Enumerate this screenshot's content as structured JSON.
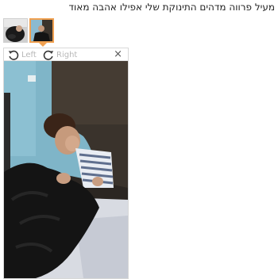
{
  "review": {
    "text": "מעיל פרווה מדהים התינוקת שלי אפילו אהבה מאוד"
  },
  "thumbnails": [
    {
      "label": "",
      "selected": false
    },
    {
      "label": "",
      "selected": true
    }
  ],
  "viewer": {
    "rotate_left_label": "Left",
    "rotate_right_label": "Right",
    "close_label": "×",
    "rotate_left_icon": "rotate-left-icon",
    "rotate_right_icon": "rotate-right-icon"
  },
  "colors": {
    "selected_border": "#f0a050",
    "wall": "#7fb5c8",
    "fur": "#141414",
    "sofa": "#3a332c"
  }
}
